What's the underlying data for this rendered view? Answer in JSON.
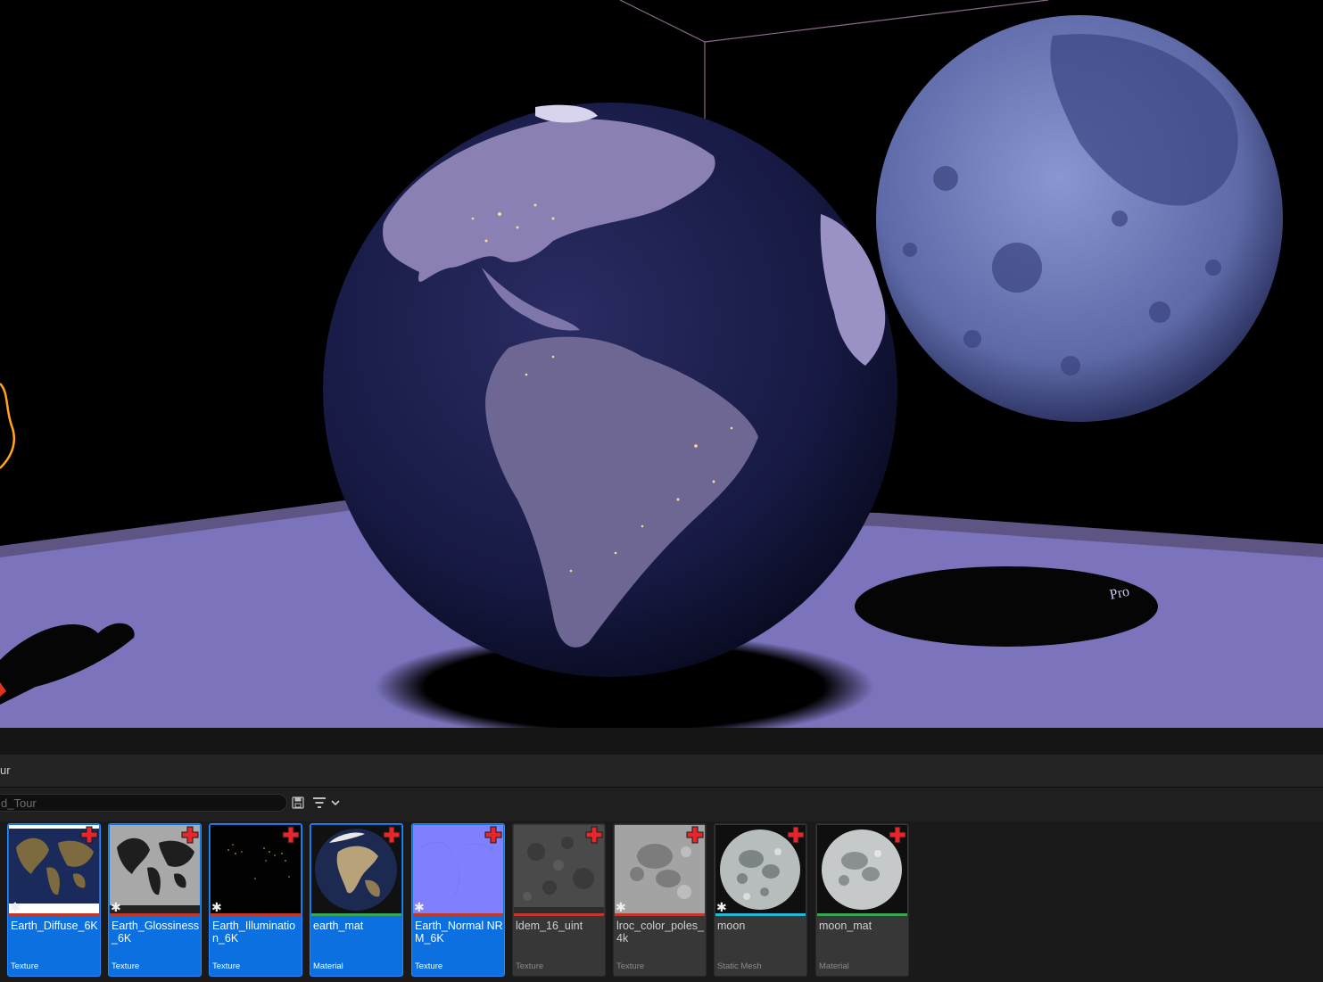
{
  "browser": {
    "path_fragment": "ur",
    "search_value": "d_Tour"
  },
  "scene": {
    "floor_label": "Pro"
  },
  "assets": [
    {
      "name": "Earth_Diffuse_6K",
      "type": "Texture",
      "selected": true,
      "type_color": "#c0392b",
      "thumb": "earth-diffuse",
      "starred": true
    },
    {
      "name": "Earth_Glossiness_6K",
      "type": "Texture",
      "selected": true,
      "type_color": "#c0392b",
      "thumb": "earth-gloss",
      "starred": true
    },
    {
      "name": "Earth_Illumination_6K",
      "type": "Texture",
      "selected": true,
      "type_color": "#c0392b",
      "thumb": "earth-illum",
      "starred": true
    },
    {
      "name": "earth_mat",
      "type": "Material",
      "selected": true,
      "type_color": "#3aa655",
      "thumb": "earth-sphere",
      "starred": false
    },
    {
      "name": "Earth_Normal NRM_6K",
      "type": "Texture",
      "selected": true,
      "type_color": "#c0392b",
      "thumb": "normal",
      "starred": true
    },
    {
      "name": "ldem_16_uint",
      "type": "Texture",
      "selected": false,
      "type_color": "#c0392b",
      "thumb": "moon-dem",
      "starred": false
    },
    {
      "name": "lroc_color_poles_4k",
      "type": "Texture",
      "selected": false,
      "type_color": "#c0392b",
      "thumb": "moon-color",
      "starred": true
    },
    {
      "name": "moon",
      "type": "Static Mesh",
      "selected": false,
      "type_color": "#22b8d6",
      "thumb": "moon-sphere",
      "starred": true
    },
    {
      "name": "moon_mat",
      "type": "Material",
      "selected": false,
      "type_color": "#3aa655",
      "thumb": "moon-sphere2",
      "starred": false
    }
  ]
}
